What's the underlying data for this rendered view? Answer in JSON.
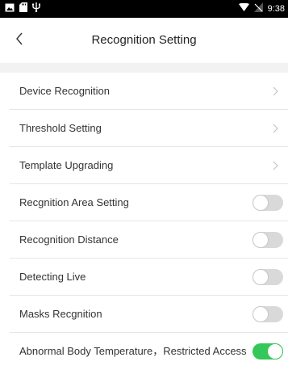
{
  "status_bar": {
    "time": "9:38",
    "left_icons": [
      "image-icon",
      "sd-card-icon",
      "usb-icon"
    ],
    "right_icons": [
      "wifi-icon",
      "no-signal-icon"
    ]
  },
  "header": {
    "back_icon": "chevron-left-icon",
    "title": "Recognition Setting"
  },
  "settings": {
    "items": [
      {
        "label": "Device Recognition",
        "control": "chevron"
      },
      {
        "label": "Threshold Setting",
        "control": "chevron"
      },
      {
        "label": "Template Upgrading",
        "control": "chevron"
      },
      {
        "label": "Recgnition Area Setting",
        "control": "toggle",
        "on": false
      },
      {
        "label": "Recognition Distance",
        "control": "toggle",
        "on": false
      },
      {
        "label": "Detecting Live",
        "control": "toggle",
        "on": false
      },
      {
        "label": "Masks Recgnition",
        "control": "toggle",
        "on": false
      },
      {
        "label": "Abnormal Body Temperature，Restricted Access",
        "control": "toggle",
        "on": true
      }
    ]
  },
  "colors": {
    "toggle_on": "#34c759",
    "toggle_off": "#d9d9d9",
    "status_bar": "#000000"
  }
}
